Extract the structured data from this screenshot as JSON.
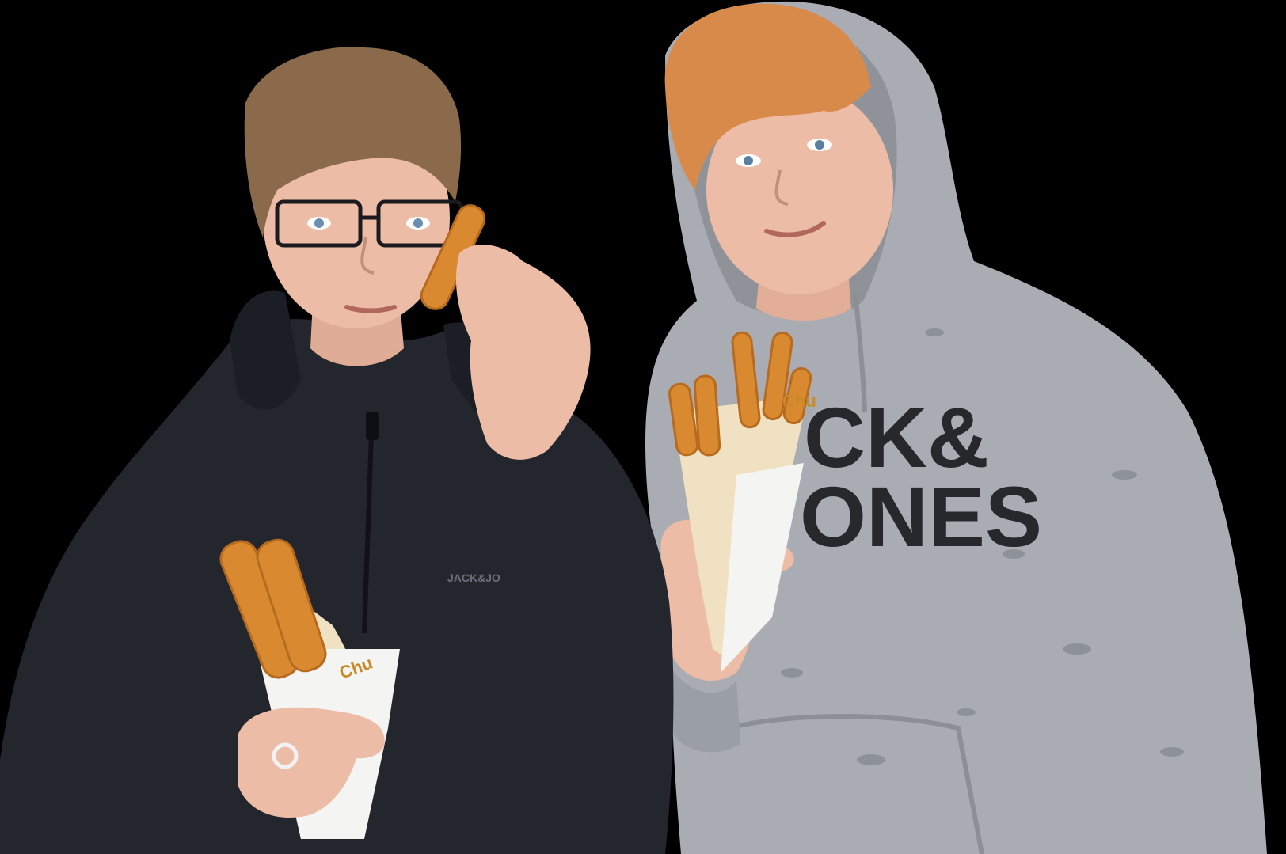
{
  "colors": {
    "background": "#000000",
    "dark_jacket": "#24262e",
    "grey_hoodie": "#a9adb3",
    "skin": "#e9b8a4",
    "brown_hair": "#8a6a4a",
    "ginger_hair": "#d88a4a",
    "churro": "#d9892f",
    "cone_paper": "#efe1c2",
    "cone_print": "#c98a2a",
    "hoodie_print": "#26282c"
  },
  "prints": {
    "hoodie_line1": "CK&",
    "hoodie_line2": "ONES",
    "jacket_logo": "JACK&JO",
    "cone_brand_left": "Chu",
    "cone_brand_right": "Chu"
  }
}
